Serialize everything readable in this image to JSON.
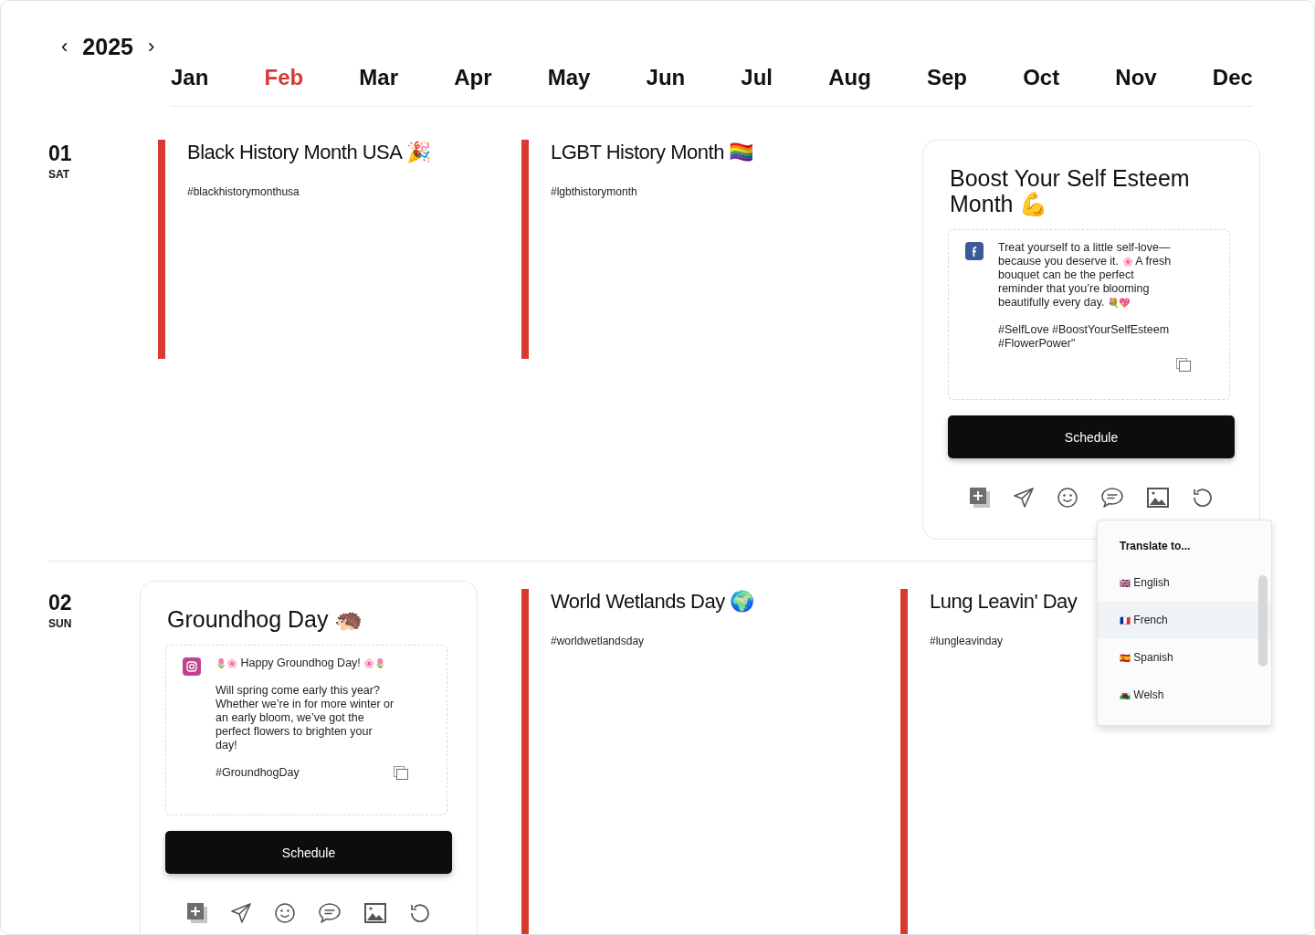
{
  "year_nav": {
    "previous": "‹",
    "year": "2025",
    "next": "›"
  },
  "months": [
    {
      "label": "Jan",
      "selected": false
    },
    {
      "label": "Feb",
      "selected": true
    },
    {
      "label": "Mar",
      "selected": false
    },
    {
      "label": "Apr",
      "selected": false
    },
    {
      "label": "May",
      "selected": false
    },
    {
      "label": "Jun",
      "selected": false
    },
    {
      "label": "Jul",
      "selected": false
    },
    {
      "label": "Aug",
      "selected": false
    },
    {
      "label": "Sep",
      "selected": false
    },
    {
      "label": "Oct",
      "selected": false
    },
    {
      "label": "Nov",
      "selected": false
    },
    {
      "label": "Dec",
      "selected": false
    }
  ],
  "days": [
    {
      "date": "01",
      "weekday": "SAT",
      "events": [
        {
          "kind": "plain",
          "title": "Black History Month USA 🎉",
          "hashtag": "#blackhistorymonthusa"
        },
        {
          "kind": "plain",
          "title": "LGBT History Month 🏳️‍🌈",
          "hashtag": "#lgbthistorymonth"
        },
        {
          "kind": "card",
          "title": "Boost Your Self Esteem Month 💪",
          "post": {
            "kind": "facebook",
            "paragraphs": [
              "Treat yourself to a little self-love—because you deserve it. 🌸 A fresh bouquet can be the perfect reminder that you’re blooming beautifully every day. 💐💖"
            ],
            "hashtags": "#SelfLove #BoostYourSelfEsteem #FlowerPower\""
          },
          "button": "Schedule",
          "translate_menu": {
            "title": "Translate to...",
            "options": [
              {
                "label": "🇬🇧 English",
                "selected": false
              },
              {
                "label": "🇫🇷 French",
                "selected": true
              },
              {
                "label": "🇪🇸 Spanish",
                "selected": false
              },
              {
                "label": "🏴󠁧󠁢󠁷󠁬󠁳󠁿 Welsh",
                "selected": false
              }
            ]
          }
        }
      ]
    },
    {
      "date": "02",
      "weekday": "SUN",
      "events": [
        {
          "kind": "card",
          "title": "Groundhog Day 🦔",
          "post": {
            "kind": "instagram",
            "paragraphs": [
              "🌷🌸 Happy Groundhog Day! 🌸🌷",
              "Will spring come early this year? Whether we’re in for more winter or an early bloom, we’ve got the perfect flowers to brighten your day!"
            ],
            "hashtags": "#GroundhogDay"
          },
          "button": "Schedule"
        },
        {
          "kind": "plain",
          "title": "World Wetlands Day 🌍",
          "hashtag": "#worldwetlandsday"
        },
        {
          "kind": "plain",
          "title": "Lung Leavin' Day",
          "hashtag": "#lungleavinday"
        }
      ]
    }
  ]
}
